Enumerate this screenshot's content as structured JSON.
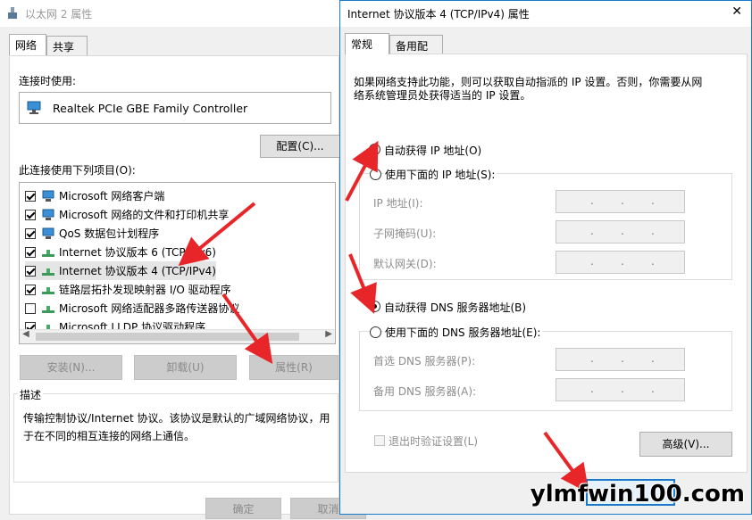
{
  "back_dialog": {
    "title": "以太网 2 属性",
    "tabs": [
      "网络",
      "共享"
    ],
    "connect_using_label": "连接时使用:",
    "adapter_name": "Realtek PCIe GBE Family Controller",
    "configure_button": "配置(C)...",
    "items_label": "此连接使用下列项目(O):",
    "items": [
      {
        "label": "Microsoft 网络客户端",
        "checked": true,
        "icon": "network-client-icon"
      },
      {
        "label": "Microsoft 网络的文件和打印机共享",
        "checked": true,
        "icon": "file-share-icon"
      },
      {
        "label": "QoS 数据包计划程序",
        "checked": true,
        "icon": "qos-icon"
      },
      {
        "label": "Internet 协议版本 6 (TCP/IPv6)",
        "checked": true,
        "icon": "protocol-icon"
      },
      {
        "label": "Internet 协议版本 4 (TCP/IPv4)",
        "checked": true,
        "icon": "protocol-icon"
      },
      {
        "label": "链路层拓扑发现映射器 I/O 驱动程序",
        "checked": true,
        "icon": "protocol-icon"
      },
      {
        "label": "Microsoft 网络适配器多路传送器协议",
        "checked": false,
        "icon": "protocol-icon"
      },
      {
        "label": "Microsoft LLDP 协议驱动程序",
        "checked": true,
        "icon": "protocol-icon"
      }
    ],
    "install_button": "安装(N)...",
    "uninstall_button": "卸载(U)",
    "properties_button": "属性(R)",
    "description_label": "描述",
    "description_text_1": "传输控制协议/Internet 协议。该协议是默认的广域网络协议，用",
    "description_text_2": "于在不同的相互连接的网络上通信。",
    "ok_button": "确定",
    "cancel_button": "取消"
  },
  "front_dialog": {
    "title": "Internet 协议版本 4 (TCP/IPv4) 属性",
    "tabs": [
      "常规",
      "备用配置"
    ],
    "intro_1": "如果网络支持此功能，则可以获取自动指派的 IP 设置。否则，你需要从网",
    "intro_2": "络系统管理员处获得适当的 IP 设置。",
    "auto_ip": "自动获得 IP 地址(O)",
    "manual_ip": "使用下面的 IP 地址(S):",
    "ip_address": "IP 地址(I):",
    "subnet_mask": "子网掩码(U):",
    "default_gateway": "默认网关(D):",
    "auto_dns": "自动获得 DNS 服务器地址(B)",
    "manual_dns": "使用下面的 DNS 服务器地址(E):",
    "preferred_dns": "首选 DNS 服务器(P):",
    "alternate_dns": "备用 DNS 服务器(A):",
    "validate_on_exit": "退出时验证设置(L)",
    "advanced_button": "高级(V)...",
    "close_glyph": "✕",
    "ip_dot": "."
  },
  "watermark": "ylmfwin100.com",
  "colors": {
    "arrow": "#e8262a",
    "accent": "#1979ca"
  }
}
